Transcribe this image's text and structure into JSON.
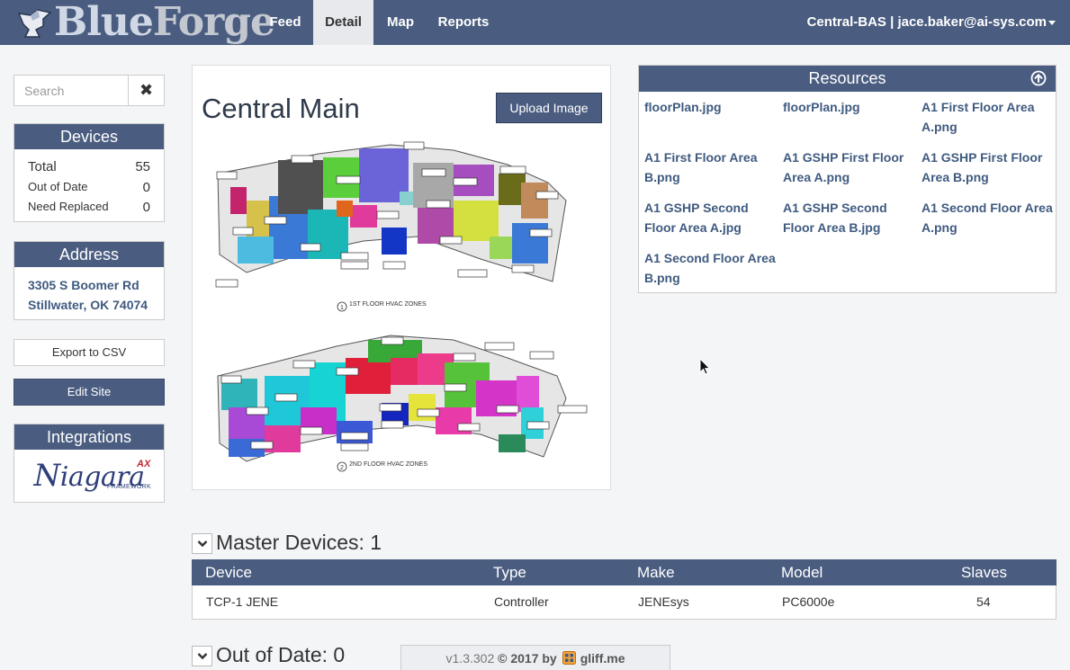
{
  "brand": {
    "name_part1": "Blue",
    "name_part2": "Forge"
  },
  "nav": {
    "tabs": [
      "Feed",
      "Detail",
      "Map",
      "Reports"
    ],
    "active": "Detail",
    "user": "Central-BAS | jace.baker@ai-sys.com"
  },
  "search": {
    "placeholder": "Search"
  },
  "devices": {
    "title": "Devices",
    "total_label": "Total",
    "total_value": "55",
    "out_of_date_label": "Out of Date",
    "out_of_date_value": "0",
    "need_replaced_label": "Need Replaced",
    "need_replaced_value": "0"
  },
  "address": {
    "title": "Address",
    "line1": "3305 S Boomer Rd",
    "line2": "Stillwater, OK 74074"
  },
  "actions": {
    "export_label": "Export to CSV",
    "edit_label": "Edit Site"
  },
  "integrations": {
    "title": "Integrations",
    "logo_word": "iagara",
    "logo_n": "N",
    "logo_ax": "AX",
    "logo_framework": "FRAMEWORK"
  },
  "site": {
    "title": "Central Main",
    "upload_label": "Upload Image"
  },
  "floorplan": {
    "floor1_caption": "1ST FLOOR HVAC ZONES",
    "floor2_caption": "2ND FLOOR HVAC ZONES",
    "floor1_label_num": "1",
    "floor2_label_num": "2"
  },
  "resources": {
    "title": "Resources",
    "files": [
      "floorPlan.jpg",
      "floorPlan.jpg",
      "A1 First Floor Area A.png",
      "A1 First Floor Area B.png",
      "A1 GSHP First Floor Area A.png",
      "A1 GSHP First Floor Area B.png",
      "A1 GSHP Second Floor Area A.jpg",
      "A1 GSHP Second Floor Area B.jpg",
      "A1 Second Floor Area A.png",
      "A1 Second Floor Area B.png"
    ]
  },
  "master_devices": {
    "title": "Master Devices: 1",
    "columns": [
      "Device",
      "Type",
      "Make",
      "Model",
      "Slaves"
    ],
    "rows": [
      [
        "TCP-1 JENE",
        "Controller",
        "JENEsys",
        "PC6000e",
        "54"
      ]
    ]
  },
  "out_of_date": {
    "title": "Out of Date: 0"
  },
  "footer": {
    "version": "v1.3.302",
    "copyright": "© 2017 by",
    "company": "gliff.me"
  },
  "colors": {
    "navbar": "#4a5d80",
    "link": "#3f5a80",
    "active_tab": "#e7e9ed"
  }
}
